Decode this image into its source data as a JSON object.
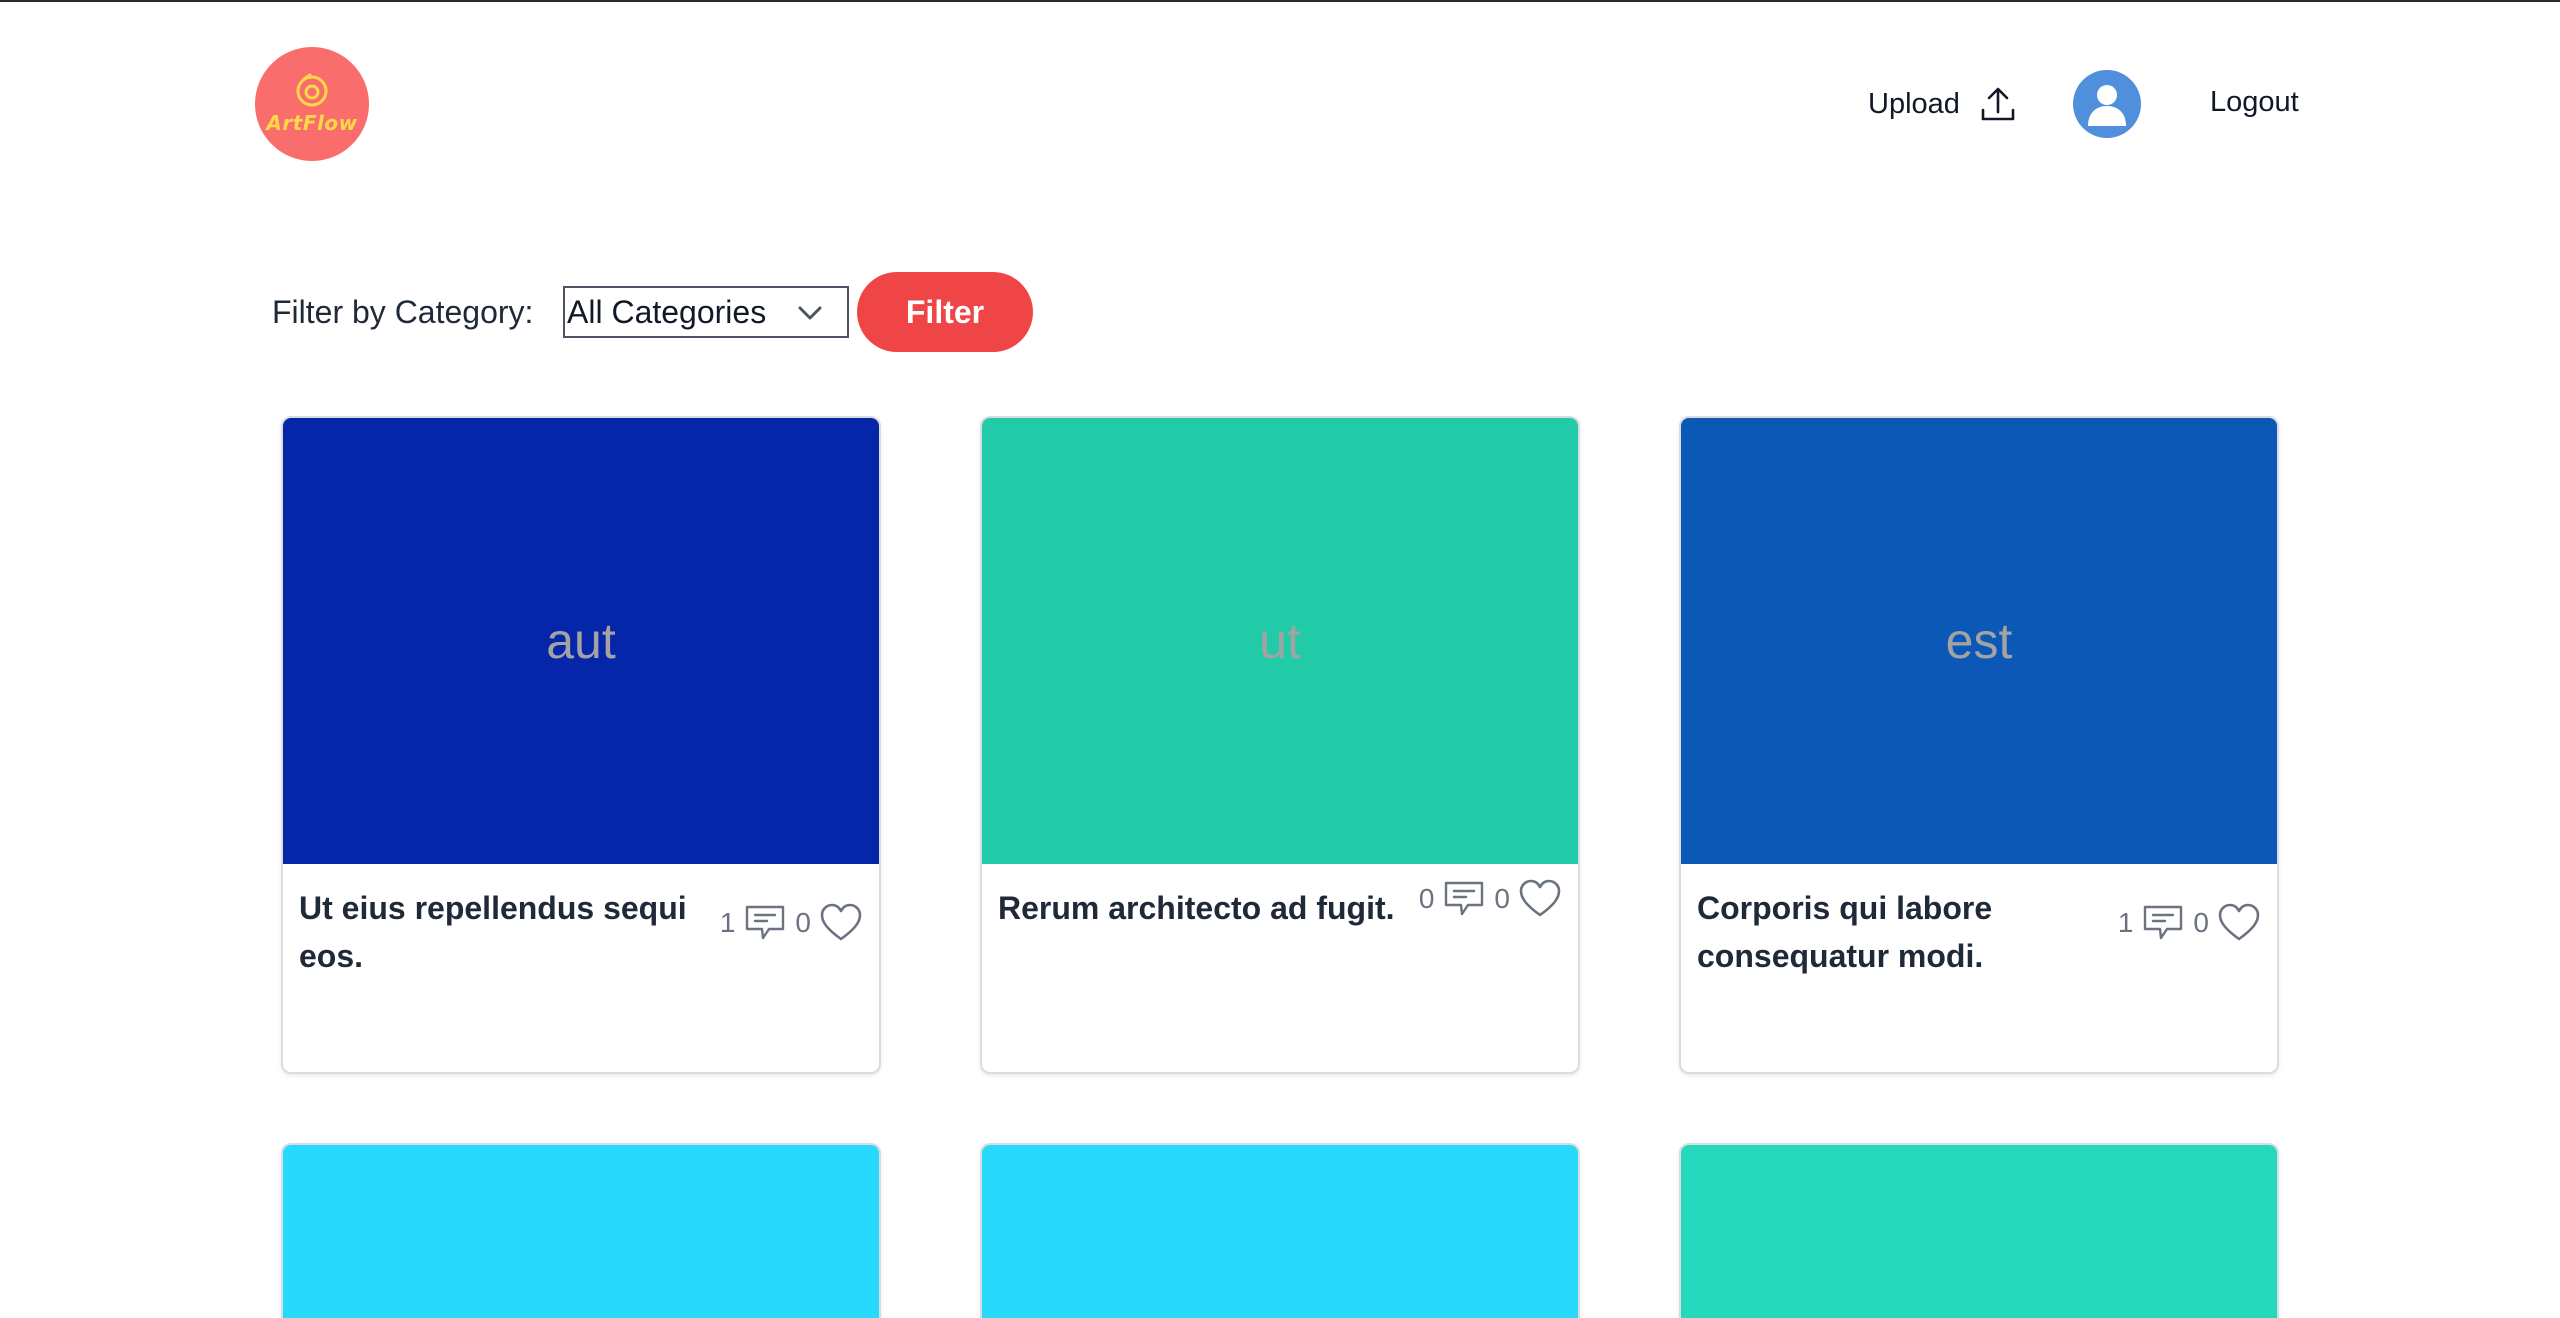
{
  "brand": {
    "name": "ArtFlow",
    "logo_color": "#f96d6c",
    "text_color": "#ffd84a"
  },
  "nav": {
    "upload_label": "Upload",
    "upload_icon": "upload-icon",
    "avatar_icon": "user-avatar-icon",
    "logout_label": "Logout"
  },
  "filter": {
    "label": "Filter by Category:",
    "selected": "All Categories",
    "button_label": "Filter",
    "button_color": "#ef4547"
  },
  "cards": [
    {
      "thumb_text": "aut",
      "thumb_color": "#0526a8",
      "title": "Ut eius repellendus sequi eos.",
      "comments": "1",
      "likes": "0"
    },
    {
      "thumb_text": "ut",
      "thumb_color": "#22cba8",
      "title": "Rerum architecto ad fugit.",
      "comments": "0",
      "likes": "0"
    },
    {
      "thumb_text": "est",
      "thumb_color": "#0c58b6",
      "title": "Corporis qui labore consequatur modi.",
      "comments": "1",
      "likes": "0"
    },
    {
      "thumb_text": "",
      "thumb_color": "#27d9fc",
      "title": "",
      "comments": "",
      "likes": ""
    },
    {
      "thumb_text": "",
      "thumb_color": "#27d9fc",
      "title": "",
      "comments": "",
      "likes": ""
    },
    {
      "thumb_text": "",
      "thumb_color": "#24d9bb",
      "title": "",
      "comments": "",
      "likes": ""
    }
  ]
}
